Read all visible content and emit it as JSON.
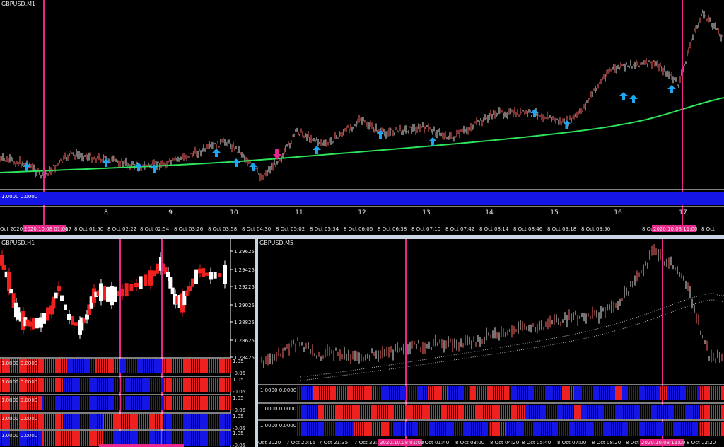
{
  "colors": {
    "accent": "#e8278a",
    "up": "#ffffff",
    "down": "#ff2a2a",
    "blue": "#1515e6",
    "red": "#ee2020",
    "ma": "#2ee35a",
    "arrow": "#1da6f2"
  },
  "top": {
    "symbol": "GBPUSD,M1",
    "indicator_label": "1.0000 0.0000",
    "day_ticks": [
      "8",
      "9",
      "10",
      "11",
      "12",
      "13",
      "14",
      "15",
      "16",
      "17"
    ],
    "time_labels": [
      "Oct 2020",
      "8 Oct 01:17",
      "8 Oct 01:50",
      "8 Oct 02:22",
      "8 Oct 02:54",
      "8 Oct 03:26",
      "8 Oct 03:58",
      "8 Oct 04:30",
      "8 Oct 05:02",
      "8 Oct 05:34",
      "8 Oct 06:06",
      "8 Oct 06:38",
      "8 Oct 07:10",
      "8 Oct 07:42",
      "8 Oct 08:14",
      "8 Oct 08:46",
      "8 Oct 09:18",
      "8 Oct 09:50",
      "8 Oct 10",
      " 8 Oct"
    ],
    "highlight_tags": [
      "2020.10.08 01:00",
      "2020.10.08 11:00"
    ]
  },
  "bl": {
    "symbol": "GBPUSD,H1",
    "price_labels": [
      "1.29625",
      "1.29425",
      "1.29225",
      "1.29025",
      "1.28825",
      "1.28625",
      "1.28425"
    ],
    "indicator_label": "1.0000 0.0000",
    "ind_scale": [
      "1.05",
      "-0.05"
    ]
  },
  "br": {
    "symbol": "GBPUSD,M5",
    "indicator_label": "1.0000 0.0000",
    "time_labels": [
      "Oct 2020",
      "7 Oct 20:15",
      "7 Oct 21:35",
      "7 Oct 22:55",
      "8 Oct 01:40",
      "8 Oct 03:00",
      "8 Oct 04:20",
      "8 Oct 05:40",
      "8 Oct 07:00",
      "8 Oct 08:20",
      "8 Oct 11:00",
      "8 Oct 12:20"
    ],
    "highlight_tags": [
      "2020.10.08 01:00",
      "2020.10.08 11:00"
    ]
  }
}
